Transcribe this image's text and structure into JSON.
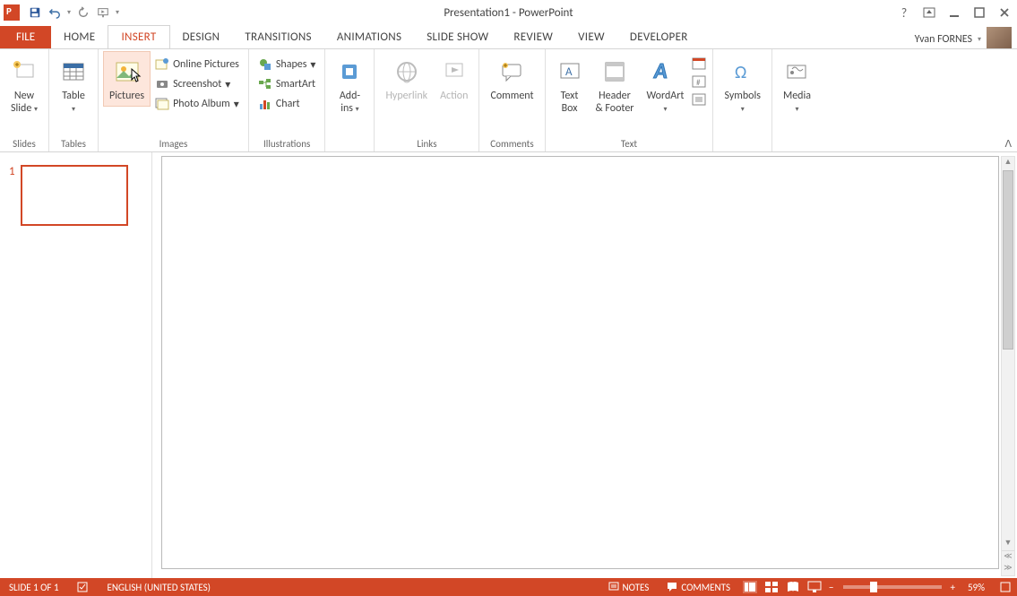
{
  "title": "Presentation1 - PowerPoint",
  "user": {
    "name": "Yvan FORNES"
  },
  "tabs": {
    "file": "FILE",
    "home": "HOME",
    "insert": "INSERT",
    "design": "DESIGN",
    "transitions": "TRANSITIONS",
    "animations": "ANIMATIONS",
    "slideshow": "SLIDE SHOW",
    "review": "REVIEW",
    "view": "VIEW",
    "developer": "DEVELOPER"
  },
  "ribbon": {
    "slides": {
      "new_slide": "New\nSlide",
      "group": "Slides"
    },
    "tables": {
      "table": "Table",
      "group": "Tables"
    },
    "images": {
      "pictures": "Pictures",
      "online_pictures": "Online Pictures",
      "screenshot": "Screenshot",
      "photo_album": "Photo Album",
      "group": "Images"
    },
    "illustrations": {
      "shapes": "Shapes",
      "smartart": "SmartArt",
      "chart": "Chart",
      "group": "Illustrations"
    },
    "addins": {
      "addins": "Add-\nins",
      "group": ""
    },
    "links": {
      "hyperlink": "Hyperlink",
      "action": "Action",
      "group": "Links"
    },
    "comments": {
      "comment": "Comment",
      "group": "Comments"
    },
    "text": {
      "text_box": "Text\nBox",
      "header_footer": "Header\n& Footer",
      "wordart": "WordArt",
      "group": "Text"
    },
    "symbols": {
      "symbols": "Symbols",
      "group": ""
    },
    "media": {
      "media": "Media",
      "group": ""
    }
  },
  "thumbs": {
    "slide1_num": "1"
  },
  "status": {
    "slide_of": "SLIDE 1 OF 1",
    "language": "ENGLISH (UNITED STATES)",
    "notes": "NOTES",
    "comments": "COMMENTS",
    "zoom": "59%"
  }
}
